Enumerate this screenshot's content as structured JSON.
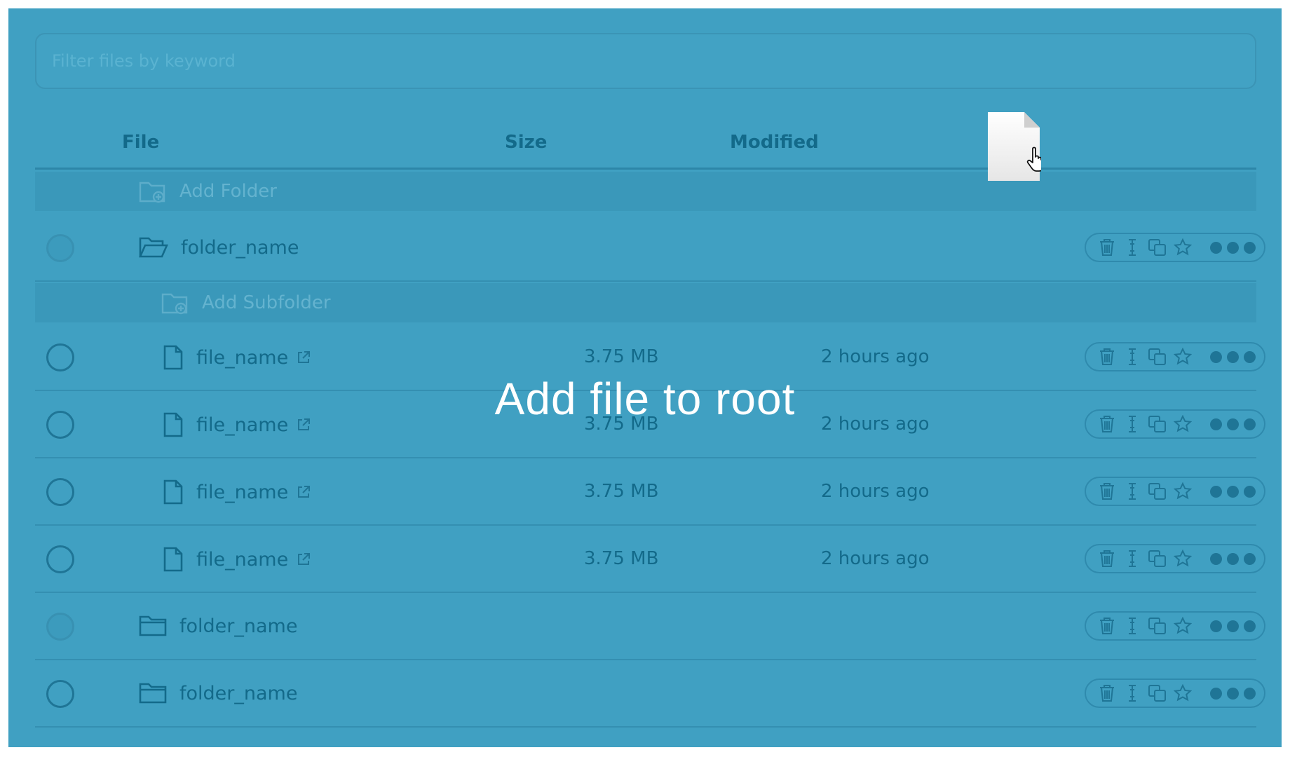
{
  "filter": {
    "placeholder": "Filter files by keyword"
  },
  "columns": {
    "file": "File",
    "size": "Size",
    "modified": "Modified"
  },
  "add_folder_label": "Add Folder",
  "add_subfolder_label": "Add Subfolder",
  "rows": [
    {
      "name": "folder_name",
      "type": "folder-open",
      "size": "",
      "modified": ""
    },
    {
      "name": "file_name",
      "type": "file",
      "size": "3.75 MB",
      "modified": "2 hours ago"
    },
    {
      "name": "file_name",
      "type": "file",
      "size": "3.75 MB",
      "modified": "2 hours ago"
    },
    {
      "name": "file_name",
      "type": "file",
      "size": "3.75 MB",
      "modified": "2 hours ago"
    },
    {
      "name": "file_name",
      "type": "file",
      "size": "3.75 MB",
      "modified": "2 hours ago"
    },
    {
      "name": "folder_name",
      "type": "folder",
      "size": "",
      "modified": ""
    },
    {
      "name": "folder_name",
      "type": "folder",
      "size": "",
      "modified": ""
    }
  ],
  "drop_overlay_text": "Add file to root",
  "icons": {
    "folder_add": "folder-plus-icon",
    "folder": "folder-icon",
    "folder_open": "folder-open-icon",
    "file": "file-icon",
    "external_link": "external-link-icon",
    "delete": "trash-icon",
    "rename": "text-cursor-icon",
    "copy": "copy-icon",
    "favorite": "star-icon",
    "more": "more-dots-icon",
    "drag": "dragged-file-icon",
    "cursor": "hand-cursor-icon"
  },
  "colors": {
    "overlay": "#40a0c2",
    "text": "#136a8a",
    "overlay_text": "#ffffff"
  }
}
